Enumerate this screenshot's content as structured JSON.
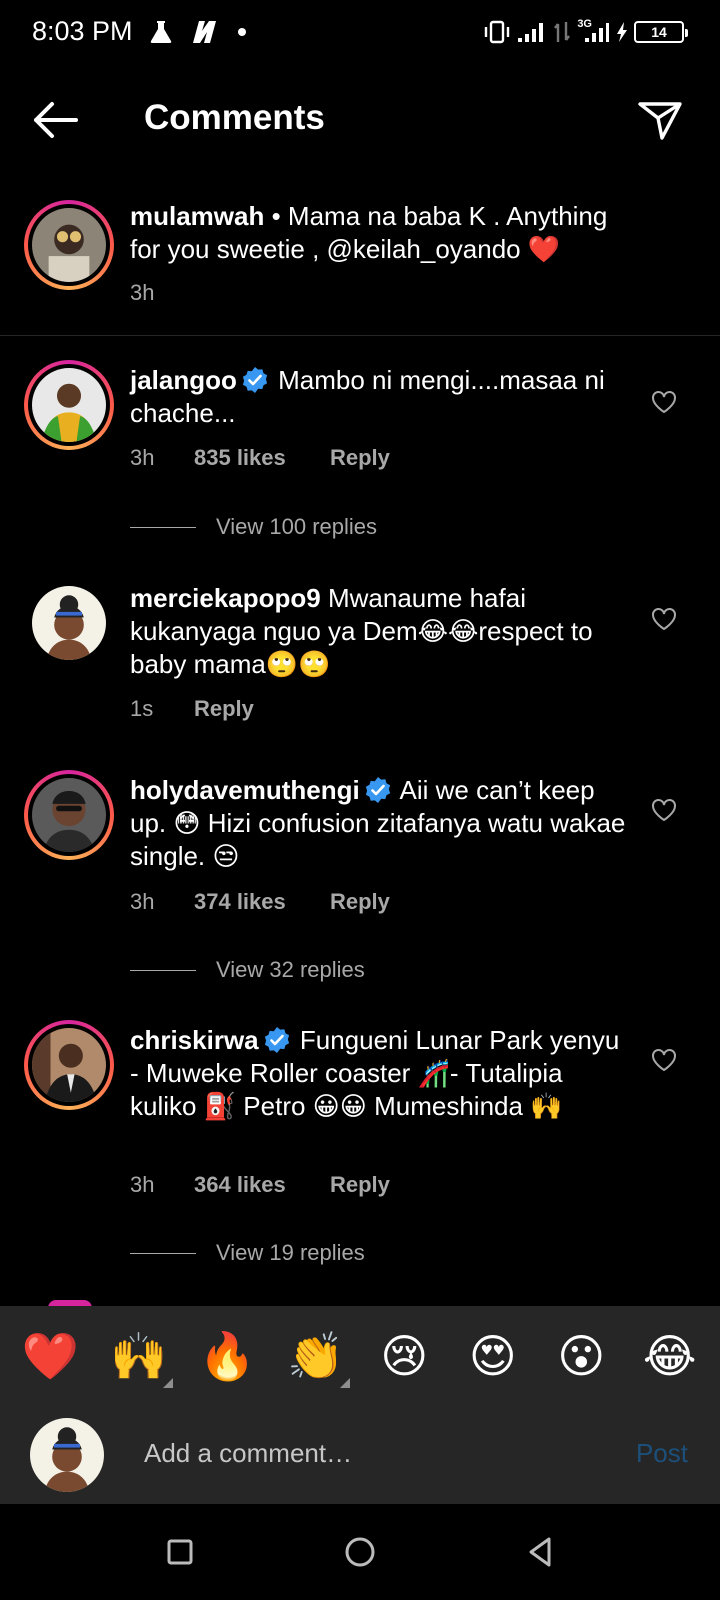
{
  "status_bar": {
    "time": "8:03 PM",
    "network_label": "3G",
    "battery_level": "14",
    "icons": [
      "flask-icon",
      "netflix-icon",
      "dot-icon",
      "vibrate-icon",
      "signal-icon",
      "data-arrows-icon",
      "signal-3g-icon",
      "charging-icon",
      "battery-icon"
    ]
  },
  "header": {
    "title": "Comments",
    "back_icon": "arrow-left-icon",
    "share_icon": "paper-plane-icon"
  },
  "caption": {
    "username": "mulamwah",
    "text": " • Mama na baba K . Anything for you sweetie , @keilah_oyando ❤️",
    "time": "3h"
  },
  "comments": [
    {
      "username": "jalangoo",
      "verified": true,
      "text": " Mambo ni mengi....masaa ni chache...",
      "time": "3h",
      "likes": "835 likes",
      "reply": "Reply",
      "view_replies": "View 100 replies"
    },
    {
      "username": "merciekapopo9",
      "verified": false,
      "text": " Mwanaume hafai kukanyaga nguo ya Dem😂😂respect to baby mama🙄🙄",
      "time": "1s",
      "reply": "Reply"
    },
    {
      "username": "holydavemuthengi",
      "verified": true,
      "text": " Aii we can’t keep up. 😳 Hizi confusion zitafanya watu wakae single. 😒",
      "time": "3h",
      "likes": "374 likes",
      "reply": "Reply",
      "view_replies": "View 32 replies"
    },
    {
      "username": "chriskirwa",
      "verified": true,
      "text": " Fungueni Lunar Park yenyu - Muweke Roller coaster 🎢- Tutalipia kuliko ⛽ Petro 😀😀 Mumeshinda 🙌",
      "time": "3h",
      "likes": "364 likes",
      "reply": "Reply",
      "view_replies": "View 19 replies"
    }
  ],
  "reactions": [
    "❤️",
    "🙌",
    "🔥",
    "👏",
    "😢",
    "😍",
    "😮",
    "😂"
  ],
  "composer": {
    "placeholder": "Add a comment…",
    "post_label": "Post"
  },
  "colors": {
    "background": "#000000",
    "secondary_text": "#a8a8a8",
    "verified_blue": "#3897f0",
    "post_disabled": "#1c4f7a",
    "bar_background": "#262626"
  }
}
